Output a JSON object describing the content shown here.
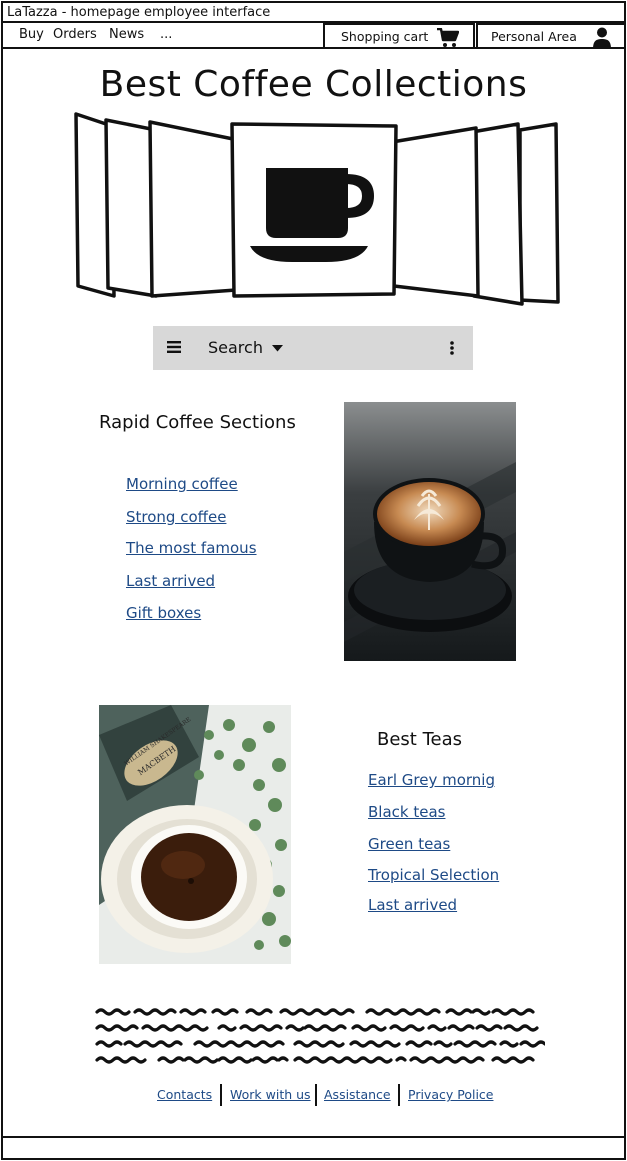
{
  "window": {
    "title": "LaTazza - homepage employee interface"
  },
  "menu": {
    "items": [
      "Buy",
      "Orders",
      "News",
      "..."
    ],
    "cart_label": "Shopping cart",
    "cart_icon": "shopping-cart-icon",
    "personal_label": "Personal Area",
    "personal_icon": "user-icon"
  },
  "hero": {
    "title": "Best Coffee Collections",
    "center_icon": "coffee-cup-icon"
  },
  "search": {
    "label": "Search"
  },
  "coffee_section": {
    "title": "Rapid Coffee Sections",
    "links": [
      "Morning coffee",
      "Strong coffee",
      "The most famous",
      "Last arrived",
      "Gift boxes"
    ]
  },
  "tea_section": {
    "title": "Best Teas",
    "links": [
      "Earl Grey mornig",
      "Black teas",
      "Green teas",
      "Tropical Selection",
      "Last arrived"
    ]
  },
  "footer": {
    "links": [
      "Contacts",
      "Work with us",
      "Assistance",
      "Privacy Police"
    ]
  },
  "colors": {
    "link": "#1e4a86",
    "search_bg": "#d8d8d8",
    "ink": "#111111"
  }
}
